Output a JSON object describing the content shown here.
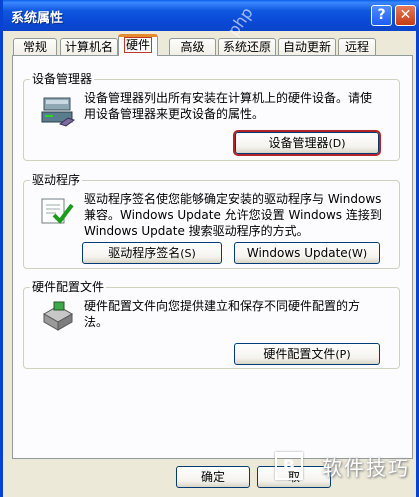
{
  "window": {
    "title": "系统属性",
    "help_label": "?",
    "close_label": "✕"
  },
  "tabs": [
    {
      "label": "常规"
    },
    {
      "label": "计算机名"
    },
    {
      "label": "硬件",
      "active": true
    },
    {
      "label": "高级"
    },
    {
      "label": "系统还原"
    },
    {
      "label": "自动更新"
    },
    {
      "label": "远程"
    }
  ],
  "device_manager": {
    "legend": "设备管理器",
    "text_line1": "设备管理器列出所有安装在计算机上的硬件设备。请使",
    "text_line2": "用设备管理器来更改设备的属性。",
    "button_label": "设备管理器",
    "button_mnemonic": "(D)",
    "icon": "device-manager-icon"
  },
  "drivers": {
    "legend": "驱动程序",
    "text_line1": "驱动程序签名使您能够确定安装的驱动程序与 Windows",
    "text_line2": "兼容。Windows Update 允许您设置 Windows 连接到",
    "text_line3": "Windows Update 搜索驱动程序的方式。",
    "signing_button_label": "驱动程序签名",
    "signing_button_mnemonic": "(S)",
    "update_button_label": "Windows Update",
    "update_button_mnemonic": "(W)",
    "icon": "driver-signing-icon"
  },
  "profiles": {
    "legend": "硬件配置文件",
    "text_line1": "硬件配置文件向您提供建立和保存不同硬件配置的方",
    "text_line2": "法。",
    "button_label": "硬件配置文件",
    "button_mnemonic": "(P)",
    "icon": "hardware-profiles-icon"
  },
  "footer": {
    "ok_label": "确定",
    "cancel_label": "取"
  },
  "watermark": {
    "text": "软件技巧",
    "box_letter": "B",
    "diagonal": "php"
  }
}
